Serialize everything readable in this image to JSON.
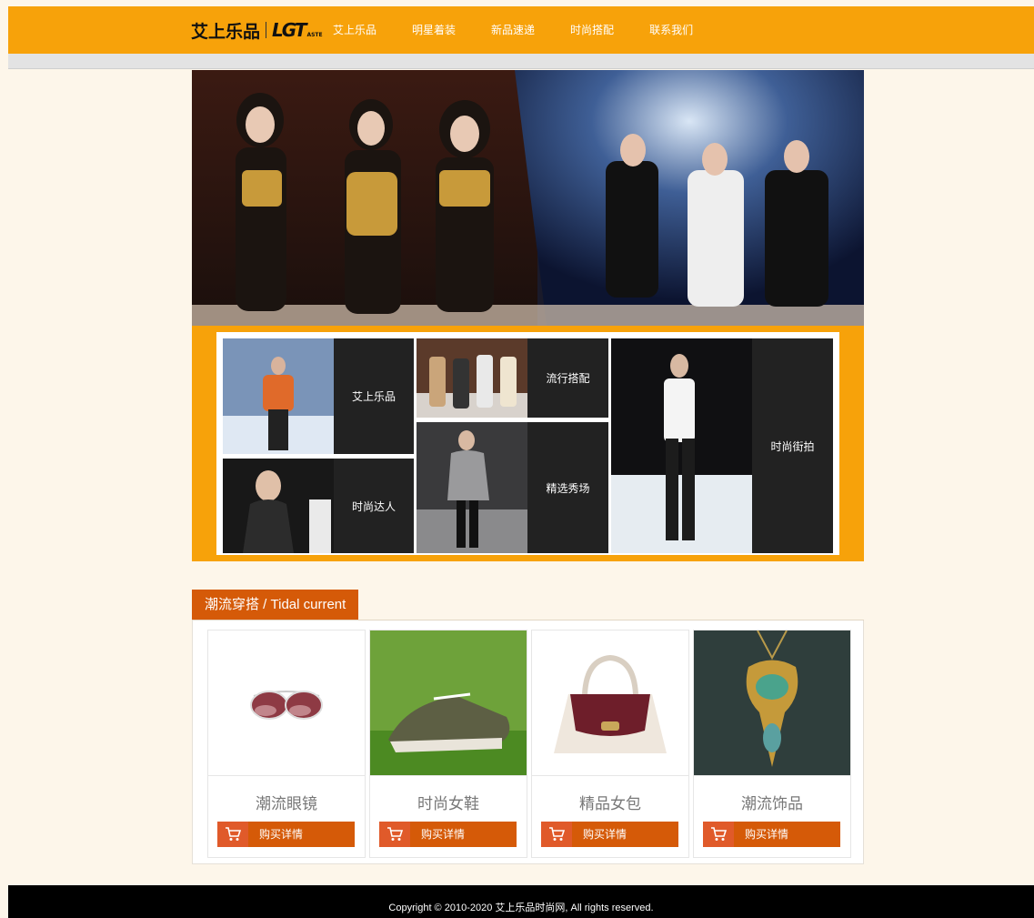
{
  "logo": {
    "cn": "艾上乐品",
    "en": "LGT",
    "en_small": "ASTE"
  },
  "nav": {
    "items": [
      {
        "label": "艾上乐品"
      },
      {
        "label": "明星着装"
      },
      {
        "label": "新品速递"
      },
      {
        "label": "时尚搭配"
      },
      {
        "label": "联系我们"
      }
    ]
  },
  "gallery": {
    "tiles": [
      {
        "caption": "艾上乐品"
      },
      {
        "caption": "流行搭配"
      },
      {
        "caption": "时尚街拍"
      },
      {
        "caption": "时尚达人"
      },
      {
        "caption": "精选秀场"
      }
    ]
  },
  "section": {
    "title": "潮流穿搭 / Tidal current"
  },
  "products": [
    {
      "name": "潮流眼镜",
      "buy_label": "购买详情"
    },
    {
      "name": "时尚女鞋",
      "buy_label": "购买详情"
    },
    {
      "name": "精品女包",
      "buy_label": "购买详情"
    },
    {
      "name": "潮流饰品",
      "buy_label": "购买详情"
    }
  ],
  "footer": {
    "copyright": "Copyright © 2010-2020 艾上乐品时尚网, All rights reserved."
  },
  "colors": {
    "accent": "#f7a20a",
    "section": "#d55a08",
    "background": "#fdf6ea",
    "footer": "#000000"
  },
  "icons": [
    "cart-icon"
  ]
}
